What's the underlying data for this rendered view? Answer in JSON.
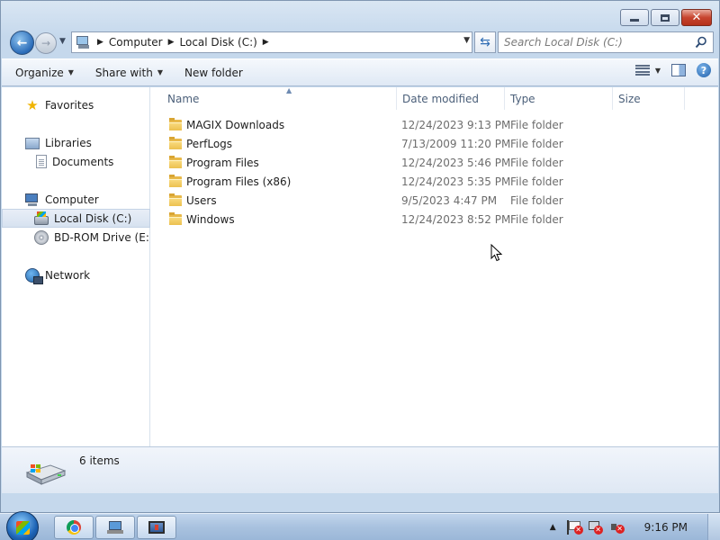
{
  "window": {
    "caption_buttons": {
      "minimize": "minimize",
      "maximize": "maximize",
      "close": "✕"
    }
  },
  "address_bar": {
    "breadcrumbs": [
      "Computer",
      "Local Disk (C:)"
    ]
  },
  "search": {
    "placeholder": "Search Local Disk (C:)"
  },
  "toolbar": {
    "organize_label": "Organize",
    "share_label": "Share with",
    "new_folder_label": "New folder"
  },
  "nav_pane": {
    "favorites": "Favorites",
    "libraries": "Libraries",
    "documents": "Documents",
    "computer": "Computer",
    "local_disk": "Local Disk (C:)",
    "bd_rom": "BD-ROM Drive (E:) v",
    "network": "Network"
  },
  "columns": {
    "name": "Name",
    "date_modified": "Date modified",
    "type": "Type",
    "size": "Size"
  },
  "files": [
    {
      "name": "MAGIX Downloads",
      "date": "12/24/2023 9:13 PM",
      "type": "File folder"
    },
    {
      "name": "PerfLogs",
      "date": "7/13/2009 11:20 PM",
      "type": "File folder"
    },
    {
      "name": "Program Files",
      "date": "12/24/2023 5:46 PM",
      "type": "File folder"
    },
    {
      "name": "Program Files (x86)",
      "date": "12/24/2023 5:35 PM",
      "type": "File folder"
    },
    {
      "name": "Users",
      "date": "9/5/2023 4:47 PM",
      "type": "File folder"
    },
    {
      "name": "Windows",
      "date": "12/24/2023 8:52 PM",
      "type": "File folder"
    }
  ],
  "details": {
    "item_count": "6 items"
  },
  "taskbar": {
    "clock": "9:16 PM",
    "buttons": [
      "chrome-icon",
      "explorer-icon",
      "media-app-icon"
    ]
  }
}
